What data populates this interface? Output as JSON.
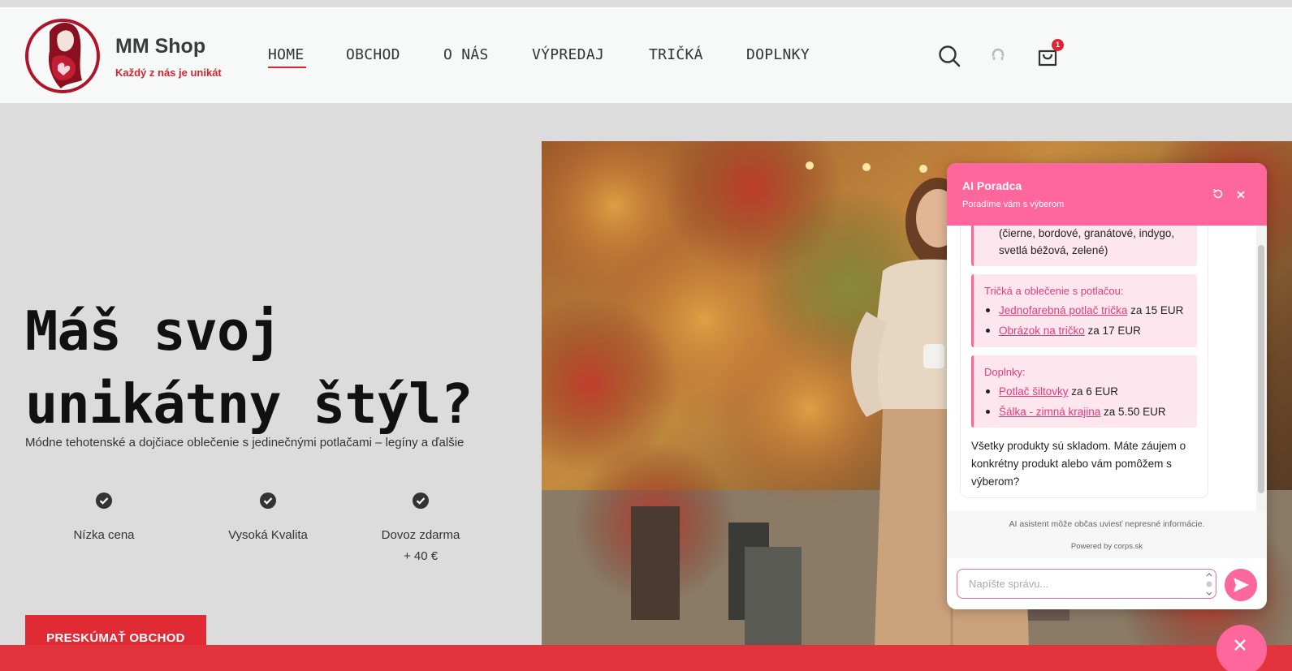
{
  "brand": {
    "name": "MM Shop",
    "tagline": "Každý z nás je unikát"
  },
  "nav": {
    "items": [
      {
        "label": "HOME",
        "active": true
      },
      {
        "label": "OBCHOD"
      },
      {
        "label": "O NÁS"
      },
      {
        "label": "VÝPREDAJ"
      },
      {
        "label": "TRIČKÁ"
      },
      {
        "label": "DOPLNKY"
      }
    ],
    "cart_count": "1",
    "icons": [
      "search-icon",
      "user-icon",
      "cart-icon"
    ]
  },
  "hero": {
    "title_line1": "Máš svoj",
    "title_line2": "unikátny štýl?",
    "subtitle": "Módne tehotenské a dojčiace oblečenie s jedinečnými potlačami – legíny a ďalšie",
    "features": [
      {
        "label": "Nízka cena"
      },
      {
        "label": "Vysoká Kvalita"
      },
      {
        "label": "Dovoz zdarma",
        "label2": "+ 40 €"
      }
    ],
    "cta": "PRESKÚMAŤ OBCHOD"
  },
  "chat": {
    "title": "AI Poradca",
    "subtitle": "Poradíme vám s výberom",
    "card1_line1": "(čierne, bordové, granátové, indygo,",
    "card1_line2": "svetlá béžová, zelené)",
    "card2": {
      "title": "Tričká a oblečenie s potlačou:",
      "items": [
        {
          "link": "Jednofarebná potlač trička",
          "price": " za 15 EUR"
        },
        {
          "link": "Obrázok na tričko",
          "price": " za 17 EUR"
        }
      ]
    },
    "card3": {
      "title": "Doplnky:",
      "items": [
        {
          "link": "Potlač šiltovky",
          "price": " za 6 EUR"
        },
        {
          "link": "Šálka - zimná krajina",
          "price": " za 5.50 EUR"
        }
      ]
    },
    "closing": "Všetky produkty sú skladom. Máte záujem o konkrétny produkt alebo vám pomôžem s výberom?",
    "disclaimer": "AI asistent môže občas uviesť nepresné informácie.",
    "powered": "Powered by corps.sk",
    "input_placeholder": "Napíšte správu..."
  },
  "colors": {
    "brand_red": "#e02b35",
    "chat_pink": "#fd679b",
    "link_pink": "#e43b7a"
  }
}
